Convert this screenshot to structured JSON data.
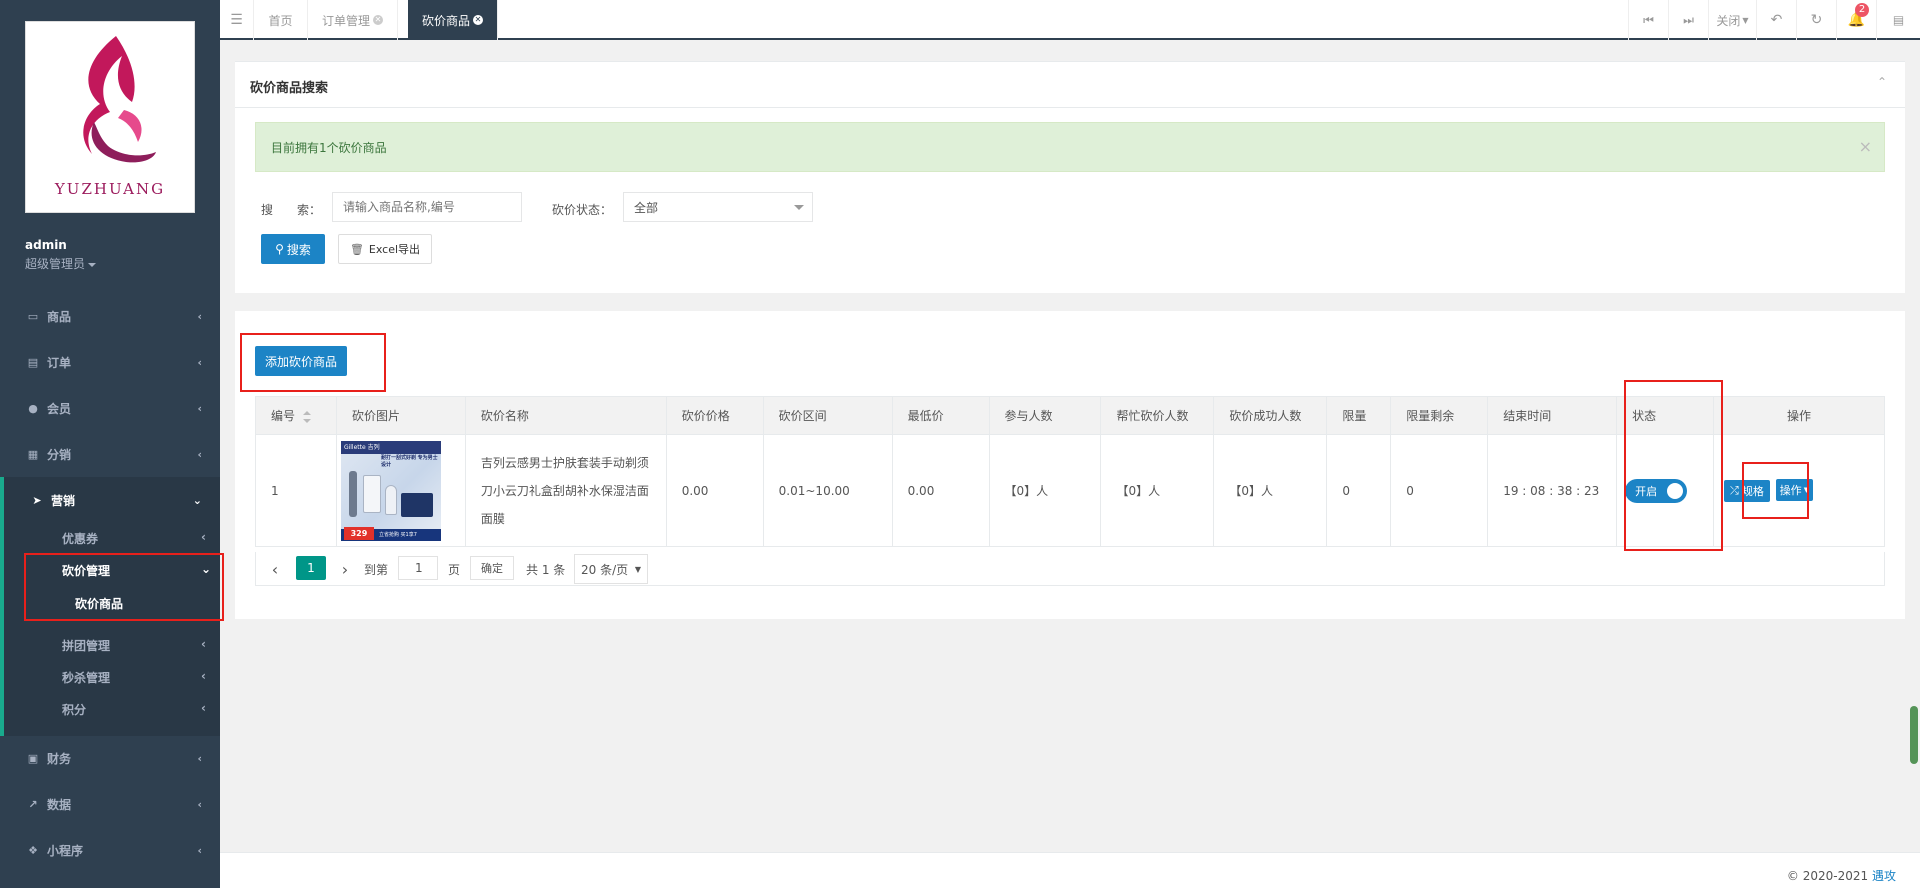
{
  "sidebar": {
    "logo_text": "YUZHUANG",
    "user_name": "admin",
    "user_role": "超级管理员",
    "items": [
      {
        "label": "商品",
        "icon": "laptop-icon"
      },
      {
        "label": "订单",
        "icon": "list-icon"
      },
      {
        "label": "会员",
        "icon": "user-icon"
      },
      {
        "label": "分销",
        "icon": "sitemap-icon"
      },
      {
        "label": "营销",
        "icon": "send-icon"
      },
      {
        "label": "财务",
        "icon": "money-icon"
      },
      {
        "label": "数据",
        "icon": "line-chart-icon"
      },
      {
        "label": "小程序",
        "icon": "cubes-icon"
      }
    ],
    "marketing_sub": {
      "coupon": "优惠券",
      "bargain_mgmt": "砍价管理",
      "bargain_goods": "砍价商品",
      "group_mgmt": "拼团管理",
      "seckill_mgmt": "秒杀管理",
      "points": "积分"
    }
  },
  "topbar": {
    "tabs": [
      "首页",
      "订单管理",
      "砍价商品"
    ],
    "close_label": "关闭",
    "notification_count": "2"
  },
  "search_panel": {
    "title": "砍价商品搜索",
    "alert": "目前拥有1个砍价商品",
    "search_label": "搜　　索：",
    "search_placeholder": "请输入商品名称,编号",
    "status_label": "砍价状态：",
    "status_value": "全部",
    "search_button": "搜索",
    "export_button": "Excel导出"
  },
  "list_panel": {
    "add_button": "添加砍价商品",
    "columns": [
      "编号",
      "砍价图片",
      "砍价名称",
      "砍价价格",
      "砍价区间",
      "最低价",
      "参与人数",
      "帮忙砍价人数",
      "砍价成功人数",
      "限量",
      "限量剩余",
      "结束时间",
      "状态",
      "操作"
    ],
    "rows": [
      {
        "id": "1",
        "name": "吉列云感男士护肤套装手动剃须刀小云刀礼盒刮胡补水保湿洁面面膜",
        "price": "0.00",
        "range": "0.01~10.00",
        "min_price": "0.00",
        "participants": "【0】人",
        "helpers": "【0】人",
        "success": "【0】人",
        "limit": "0",
        "remaining": "0",
        "end_time": "19 : 08 : 38 : 23",
        "status": "开启",
        "spec_button": "规格",
        "ops_button": "操作"
      }
    ],
    "thumb": {
      "brand": "Gillette 吉列",
      "slogan": "耐打一刮式好剃 专为男士设计",
      "price_tag": "329",
      "promo": "立省抢购 买1享7"
    }
  },
  "pagination": {
    "current_page": "1",
    "goto_label": "到第",
    "goto_value": "1",
    "page_unit": "页",
    "confirm": "确定",
    "total": "共 1 条",
    "page_size": "20 条/页"
  },
  "footer": {
    "copyright": "© 2020-2021",
    "link": "遇攻"
  },
  "colors": {
    "sidebar_bg": "#2f4050",
    "accent_blue": "#1c84c6",
    "accent_green": "#19aa8d",
    "highlight_red": "#e8201b"
  }
}
